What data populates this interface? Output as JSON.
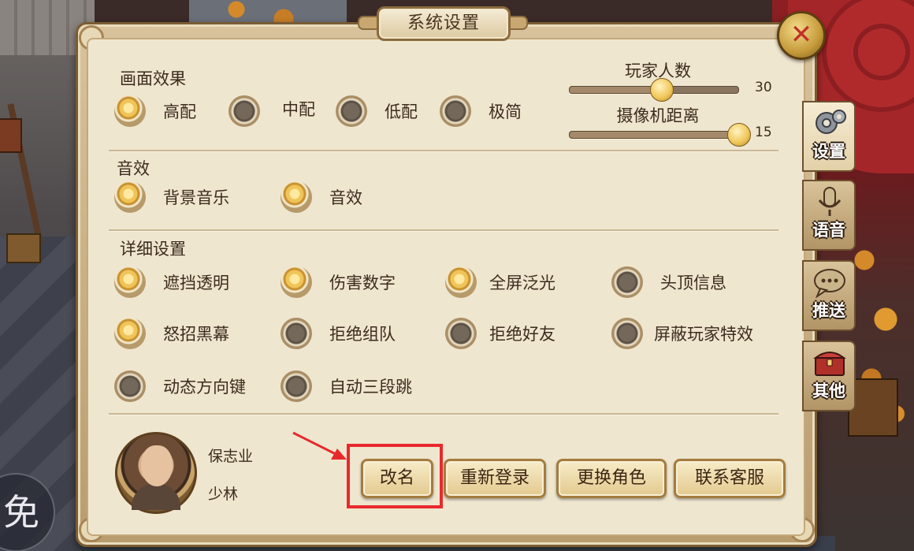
{
  "window": {
    "title": "系统设置"
  },
  "graphics": {
    "title": "画面效果",
    "options": [
      {
        "label": "高配",
        "checked": true
      },
      {
        "label": "中配",
        "checked": false
      },
      {
        "label": "低配",
        "checked": false
      },
      {
        "label": "极简",
        "checked": false
      }
    ]
  },
  "sliders": [
    {
      "label": "玩家人数",
      "value": "30",
      "fraction": 0.54
    },
    {
      "label": "摄像机距离",
      "value": "15",
      "fraction": 1.0
    }
  ],
  "sound": {
    "title": "音效",
    "options": [
      {
        "label": "背景音乐",
        "checked": true
      },
      {
        "label": "音效",
        "checked": true
      }
    ]
  },
  "details": {
    "title": "详细设置",
    "options": [
      {
        "label": "遮挡透明",
        "checked": true
      },
      {
        "label": "伤害数字",
        "checked": true
      },
      {
        "label": "全屏泛光",
        "checked": true
      },
      {
        "label": "头顶信息",
        "checked": false
      },
      {
        "label": "怒招黑幕",
        "checked": true
      },
      {
        "label": "拒绝组队",
        "checked": false
      },
      {
        "label": "拒绝好友",
        "checked": false
      },
      {
        "label": "屏蔽玩家特效",
        "checked": false
      },
      {
        "label": "动态方向键",
        "checked": false
      },
      {
        "label": "自动三段跳",
        "checked": false
      }
    ]
  },
  "side_tabs": [
    {
      "label": "设置",
      "icon": "gear-icon",
      "active": true
    },
    {
      "label": "语音",
      "icon": "microphone-icon",
      "active": false
    },
    {
      "label": "推送",
      "icon": "chat-bubble-icon",
      "active": false
    },
    {
      "label": "其他",
      "icon": "treasure-chest-icon",
      "active": false
    }
  ],
  "profile": {
    "name": "保志业",
    "school": "少林"
  },
  "buttons": {
    "rename": "改名",
    "relogin": "重新登录",
    "switch_role": "更换角色",
    "contact_support": "联系客服"
  },
  "hud": {
    "left_button_glyph": "免"
  },
  "colors": {
    "highlight": "#e8292c",
    "panel_bg": "#efe6cf",
    "frame": "#7a5c34"
  }
}
